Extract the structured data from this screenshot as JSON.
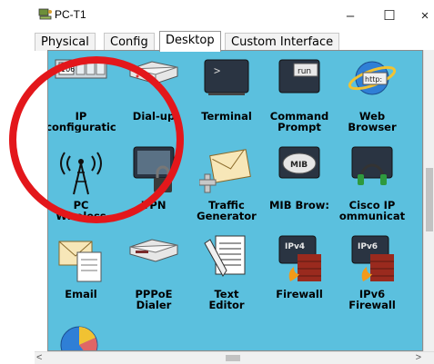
{
  "window": {
    "title": "PC-T1",
    "minimize_glyph": "–",
    "maximize_glyph": "☐",
    "close_glyph": "×"
  },
  "tabs": [
    {
      "label": "Physical"
    },
    {
      "label": "Config"
    },
    {
      "label": "Desktop",
      "active": true
    },
    {
      "label": "Custom Interface"
    }
  ],
  "apps": [
    {
      "name": "IP\nconfiguratic",
      "icon": "ip-configuration-icon",
      "icon_text": "106"
    },
    {
      "name": "Dial-up",
      "icon": "dial-up-icon"
    },
    {
      "name": "Terminal",
      "icon": "terminal-icon",
      "icon_text": ">"
    },
    {
      "name": "Command\nPrompt",
      "icon": "command-prompt-icon",
      "icon_text": "run"
    },
    {
      "name": "Web\nBrowser",
      "icon": "web-browser-icon",
      "icon_text": "http:"
    },
    {
      "name": "PC\nWireless",
      "icon": "pc-wireless-icon"
    },
    {
      "name": "VPN",
      "icon": "vpn-icon"
    },
    {
      "name": "Traffic\nGenerator",
      "icon": "traffic-generator-icon"
    },
    {
      "name": "MIB Brow:",
      "icon": "mib-browser-icon",
      "icon_text": "MIB"
    },
    {
      "name": "Cisco IP\nommunicat",
      "icon": "cisco-ip-communicator-icon"
    },
    {
      "name": "Email",
      "icon": "email-icon"
    },
    {
      "name": "PPPoE\nDialer",
      "icon": "pppoe-dialer-icon"
    },
    {
      "name": "Text\nEditor",
      "icon": "text-editor-icon"
    },
    {
      "name": "Firewall",
      "icon": "firewall-icon",
      "icon_text": "IPv4"
    },
    {
      "name": "IPv6\nFirewall",
      "icon": "ipv6-firewall-icon",
      "icon_text": "IPv6"
    },
    {
      "name": "",
      "icon": "pie-chart-app-icon"
    }
  ],
  "colors": {
    "panel_bg": "#5bc0de",
    "annotation_red": "#e3171b"
  }
}
